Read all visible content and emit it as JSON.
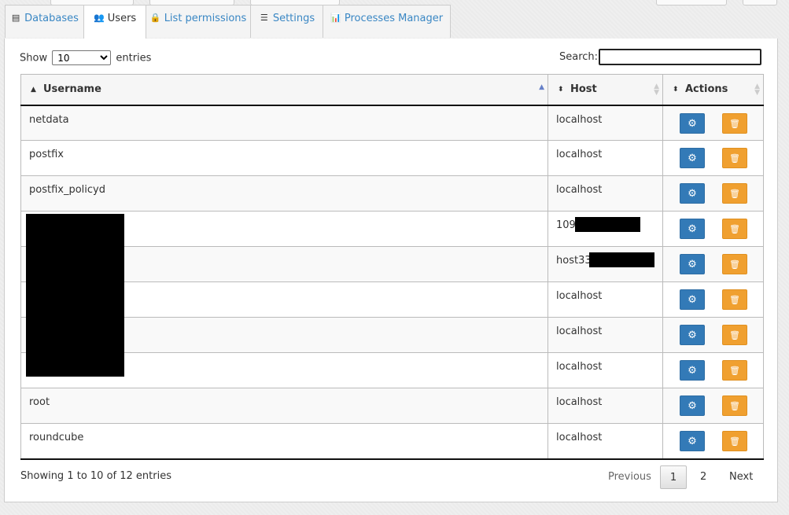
{
  "tabs": [
    {
      "label": "Databases",
      "icon": "database-icon",
      "glyph": "▤"
    },
    {
      "label": "Users",
      "icon": "users-icon",
      "glyph": "👥"
    },
    {
      "label": "List permissions",
      "icon": "lock-icon",
      "glyph": "🔒"
    },
    {
      "label": "Settings",
      "icon": "sliders-icon",
      "glyph": "☰"
    },
    {
      "label": "Processes Manager",
      "icon": "bar-chart-icon",
      "glyph": "📊"
    }
  ],
  "length": {
    "prefix": "Show",
    "value": "10",
    "suffix": "entries"
  },
  "search": {
    "label": "Search:",
    "value": ""
  },
  "columns": {
    "username": "Username",
    "host": "Host",
    "actions": "Actions"
  },
  "rows": [
    {
      "username": "netdata",
      "host": "localhost"
    },
    {
      "username": "postfix",
      "host": "localhost"
    },
    {
      "username": "postfix_policyd",
      "host": "localhost"
    },
    {
      "username": "",
      "host": "109."
    },
    {
      "username": "",
      "host": "host33."
    },
    {
      "username": "",
      "host": "localhost"
    },
    {
      "username": "",
      "host": "localhost"
    },
    {
      "username": "",
      "host": "localhost"
    },
    {
      "username": "root",
      "host": "localhost"
    },
    {
      "username": "roundcube",
      "host": "localhost"
    }
  ],
  "info": "Showing 1 to 10 of 12 entries",
  "pagination": {
    "previous": "Previous",
    "pages": [
      "1",
      "2"
    ],
    "current": "1",
    "next": "Next"
  },
  "colors": {
    "link": "#3a87c4",
    "edit_button": "#337ab7",
    "delete_button": "#f0a030"
  }
}
